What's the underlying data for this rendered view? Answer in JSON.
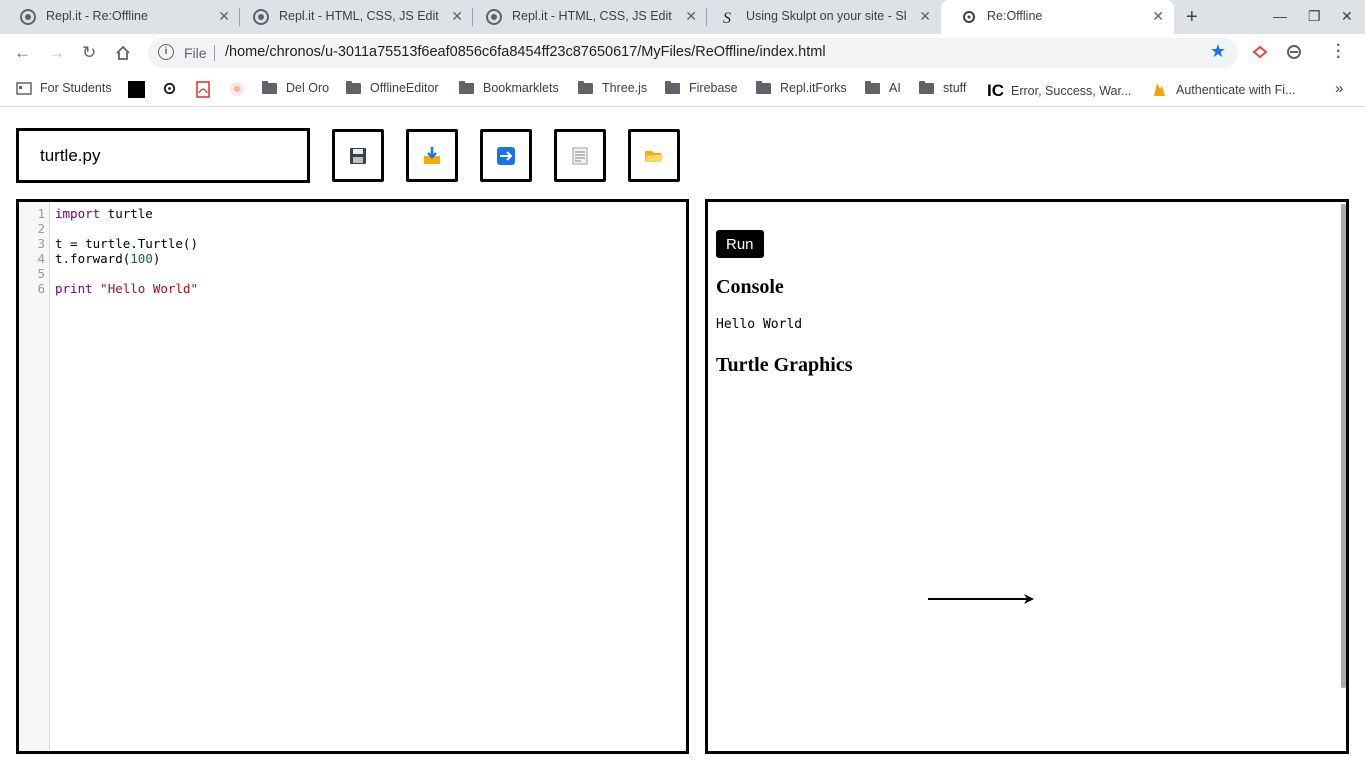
{
  "browser": {
    "tabs": [
      {
        "title": "Repl.it - Re:Offline",
        "icon": "replit-icon"
      },
      {
        "title": "Repl.it - HTML, CSS, JS Editor",
        "icon": "replit-icon"
      },
      {
        "title": "Repl.it - HTML, CSS, JS Editor",
        "icon": "replit-icon"
      },
      {
        "title": "Using Skulpt on your site - Sk",
        "icon": "skulpt-icon"
      },
      {
        "title": "Re:Offline",
        "icon": "gear-icon"
      }
    ],
    "address": {
      "scheme_label": "File",
      "url": "/home/chronos/u-3011a75513f6eaf0856c6fa8454ff23c87650617/MyFiles/ReOffline/index.html"
    },
    "bookmarks": [
      {
        "label": "For Students",
        "icon": "folder-icon"
      },
      {
        "label": "",
        "icon": "black-square-icon"
      },
      {
        "label": "",
        "icon": "gear-icon"
      },
      {
        "label": "",
        "icon": "pdf-icon"
      },
      {
        "label": "",
        "icon": "image-icon"
      },
      {
        "label": "Del Oro",
        "icon": "folder-icon"
      },
      {
        "label": "OfflineEditor",
        "icon": "folder-icon"
      },
      {
        "label": "Bookmarklets",
        "icon": "folder-icon"
      },
      {
        "label": "Three.js",
        "icon": "folder-icon"
      },
      {
        "label": "Firebase",
        "icon": "folder-icon"
      },
      {
        "label": "Repl.itForks",
        "icon": "folder-icon"
      },
      {
        "label": "AI",
        "icon": "folder-icon"
      },
      {
        "label": "stuff",
        "icon": "folder-icon"
      },
      {
        "label": "Error, Success, War...",
        "icon": "ic-icon"
      },
      {
        "label": "Authenticate with Fi...",
        "icon": "firebase-icon"
      }
    ],
    "ic_logo_text": "IC",
    "more_label": "»"
  },
  "app": {
    "filename": "turtle.py",
    "toolbar_icons": [
      "save-icon",
      "download-icon",
      "arrow-right-icon",
      "document-icon",
      "folder-open-icon"
    ],
    "editor": {
      "line_numbers": [
        "1",
        "2",
        "3",
        "4",
        "5",
        "6"
      ],
      "lines": [
        {
          "kw": "import",
          "rest": " turtle"
        },
        {
          "text": ""
        },
        {
          "text": "t = turtle.Turtle()"
        },
        {
          "pre": "t.forward(",
          "num": "100",
          "post": ")"
        },
        {
          "text": ""
        },
        {
          "kw": "print",
          "rest": " ",
          "str": "\"Hello World\""
        }
      ]
    },
    "output": {
      "run_label": "Run",
      "console_heading": "Console",
      "console_output": "Hello World",
      "turtle_heading": "Turtle Graphics",
      "turtle_forward": 100
    }
  }
}
